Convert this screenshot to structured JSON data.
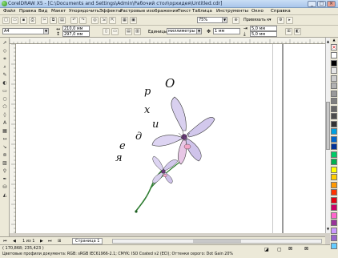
{
  "titlebar": {
    "title": "CorelDRAW X5 - [C:\\Documents and Settings\\Admin\\Рабочий стол\\орхидея\\Untitled.cdr]",
    "minimize": "_",
    "maximize": "□",
    "close": "×"
  },
  "menubar": {
    "items": [
      "Файл",
      "Правка",
      "Вид",
      "Макет",
      "Упорядочить",
      "Эффекты",
      "Растровые изображения",
      "Текст",
      "Таблица",
      "Инструменты",
      "Окно",
      "Справка"
    ]
  },
  "toolbar1": {
    "zoom_value": "75%",
    "snap_label": "Привязать к"
  },
  "toolbar2": {
    "paper_type": "A4",
    "width_value": "210,0 мм",
    "height_value": "297,0 мм",
    "units_label": "Единицы:",
    "units_value": "миллиметры",
    "nudge_value": "1 мм",
    "dup_x": "5,0 мм",
    "dup_y": "5,0 мм"
  },
  "canvas": {
    "letters": [
      "О",
      "р",
      "х",
      "и",
      "д",
      "е",
      "я"
    ]
  },
  "pagebar": {
    "page_counter": "1 из 1",
    "page_tab": "Страница 1"
  },
  "statusbar": {
    "coordinates": "( 170,868; 235,423 )",
    "color_profiles": "Цветовые профили документа: RGB: sRGB IEC61966-2.1; CMYK: ISO Coated v2 (ECI); Оттенки серого: Dot Gain 20%"
  },
  "palette_colors": [
    "#ffffff",
    "#000000",
    "#e5e5e5",
    "#cccccc",
    "#b2b2b2",
    "#999999",
    "#7f7f7f",
    "#666666",
    "#4c4c4c",
    "#333333",
    "#00a0e0",
    "#0066cc",
    "#003399",
    "#00cc66",
    "#00b050",
    "#ffff00",
    "#ffcc00",
    "#ff9900",
    "#ff3300",
    "#e60012",
    "#cc0066",
    "#ff66cc",
    "#993399",
    "#cc99ff",
    "#9966cc",
    "#66ccff"
  ]
}
